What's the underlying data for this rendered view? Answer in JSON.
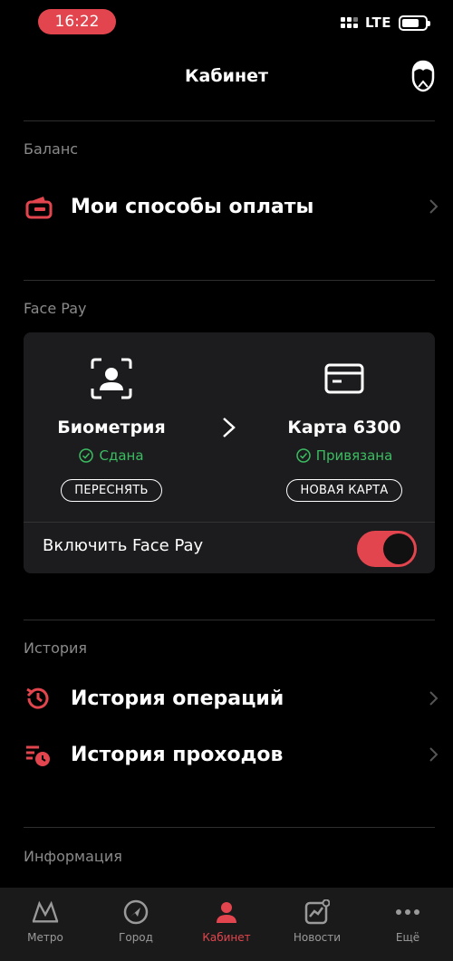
{
  "status_bar": {
    "time": "16:22",
    "network": "LTE"
  },
  "header": {
    "title": "Кабинет"
  },
  "balance": {
    "section_label": "Баланс",
    "payment_methods_label": "Мои способы оплаты"
  },
  "face_pay": {
    "section_label": "Face Pay",
    "biometry": {
      "title": "Биометрия",
      "status": "Сдана",
      "button": "ПЕРЕСНЯТЬ"
    },
    "card": {
      "title": "Карта 6300",
      "status": "Привязана",
      "button": "НОВАЯ КАРТА"
    },
    "toggle_label": "Включить Face Pay",
    "toggle_on": true
  },
  "history": {
    "section_label": "История",
    "operations_label": "История операций",
    "passes_label": "История проходов"
  },
  "info": {
    "section_label": "Информация"
  },
  "tabbar": {
    "items": [
      {
        "label": "Метро",
        "icon": "metro-icon"
      },
      {
        "label": "Город",
        "icon": "compass-icon"
      },
      {
        "label": "Кабинет",
        "icon": "person-icon",
        "active": true
      },
      {
        "label": "Новости",
        "icon": "news-chart-icon"
      },
      {
        "label": "Ещё",
        "icon": "more-dots-icon"
      }
    ]
  },
  "colors": {
    "accent": "#e2454d",
    "success": "#3bbd61",
    "background": "#000000",
    "card": "#1c1c1e"
  }
}
